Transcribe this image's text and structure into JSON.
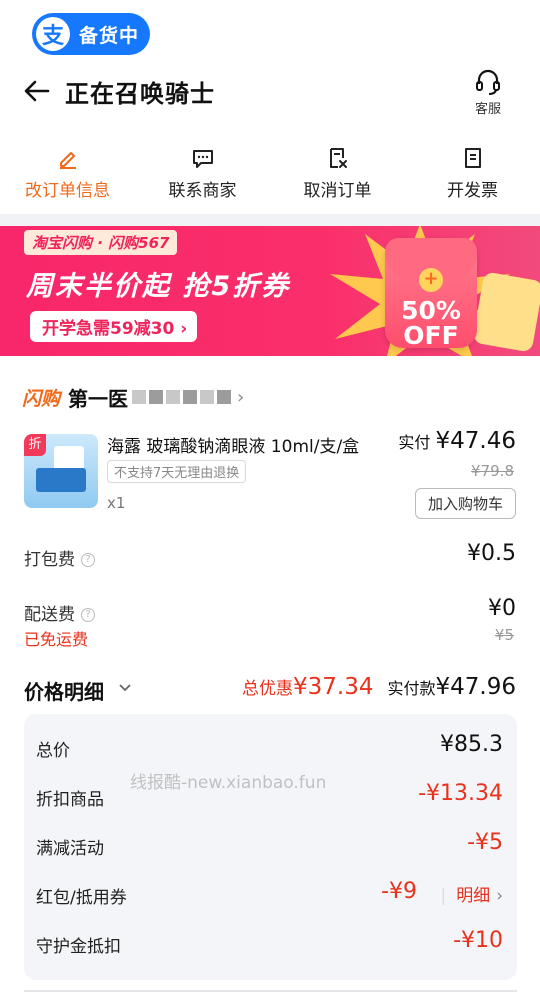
{
  "status_pill": {
    "logo": "支",
    "text": "备货中"
  },
  "header": {
    "title": "正在召唤骑士",
    "service_label": "客服"
  },
  "actions": [
    {
      "label": "改订单信息",
      "icon": "edit-icon"
    },
    {
      "label": "联系商家",
      "icon": "chat-icon"
    },
    {
      "label": "取消订单",
      "icon": "cancel-order-icon"
    },
    {
      "label": "开发票",
      "icon": "invoice-icon"
    }
  ],
  "banner": {
    "tag": "淘宝闪购 · 闪购567",
    "headline": "周末半价起  抢5折券",
    "coupon": "开学急需59减30 ›",
    "redpacket_coin": "+",
    "redpacket_text": "50% OFF"
  },
  "store": {
    "flash_logo": "闪购",
    "name": "第一医"
  },
  "product": {
    "discount_corner": "折",
    "name": "海露 玻璃酸钠滴眼液 10ml/支/盒",
    "no_return_tag": "不支持7天无理由退换",
    "qty": "x1",
    "paid_label": "实付",
    "paid_value": "¥47.46",
    "orig_price": "¥79.8",
    "cart_button": "加入购物车"
  },
  "fees": {
    "packing_label": "打包费",
    "packing_value": "¥0.5",
    "delivery_label": "配送费",
    "delivery_value": "¥0",
    "delivery_orig": "¥5",
    "free_shipping": "已免运费"
  },
  "summary": {
    "title": "价格明细",
    "total_discount_label": "总优惠",
    "total_discount_value": "¥37.34",
    "total_paid_label": "实付款",
    "total_paid_value": "¥47.96"
  },
  "details": {
    "total_label": "总价",
    "total_value": "¥85.3",
    "discount_goods_label": "折扣商品",
    "discount_goods_value": "-¥13.34",
    "full_reduction_label": "满减活动",
    "full_reduction_value": "-¥5",
    "coupon_label": "红包/抵用券",
    "coupon_value": "-¥9",
    "coupon_link": "明细",
    "guard_label": "守护金抵扣",
    "guard_value": "-¥10"
  },
  "watermark": "线报酷-new.xianbao.fun",
  "colors": {
    "accent_orange": "#f06a1c",
    "price_red": "#e8321c",
    "banner_pink": "#f8266a",
    "status_blue": "#1677ff"
  }
}
